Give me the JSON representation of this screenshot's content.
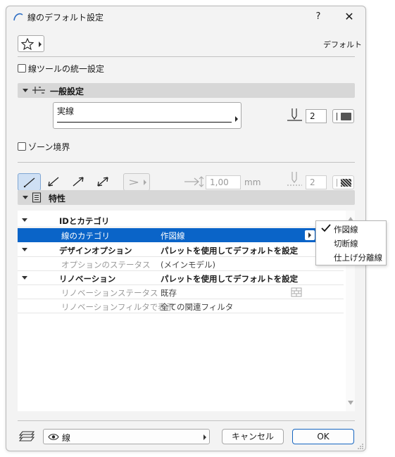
{
  "window": {
    "title": "線のデフォルト設定",
    "help_label": "?",
    "close_label": "✕"
  },
  "favorites": {
    "icon": "star-icon"
  },
  "default_label": "デフォルト",
  "unified_settings": {
    "label": "線ツールの統一設定",
    "checked": false
  },
  "general": {
    "title": "一般設定",
    "line_type": "実線",
    "pen_number": "2"
  },
  "zone_boundary": {
    "label": "ゾーン境界",
    "checked": false
  },
  "geometry": {
    "length_value": "1,00",
    "length_unit": "mm",
    "pen_number": "2"
  },
  "properties": {
    "title": "特性",
    "rows": [
      {
        "name": "IDとカテゴリ",
        "value": ""
      },
      {
        "name": "線のカテゴリ",
        "value": "作図線"
      },
      {
        "name": "デザインオプション",
        "value": "パレットを使用してデフォルトを設定"
      },
      {
        "name": "オプションのステータス",
        "value": "(メインモデル)"
      },
      {
        "name": "リノベーション",
        "value": "パレットを使用してデフォルトを設定"
      },
      {
        "name": "リノベーションステータス",
        "value": "既存"
      },
      {
        "name": "リノベーションフィルタで表示",
        "value": "全ての関連フィルタ"
      }
    ]
  },
  "category_popup": {
    "items": [
      "作図線",
      "切断線",
      "仕上げ分離線"
    ],
    "selected": "作図線"
  },
  "footer": {
    "view": "線",
    "cancel_label": "キャンセル",
    "ok_label": "OK"
  },
  "colors": {
    "selection": "#0a64c8",
    "ok_border": "#1565c0"
  }
}
